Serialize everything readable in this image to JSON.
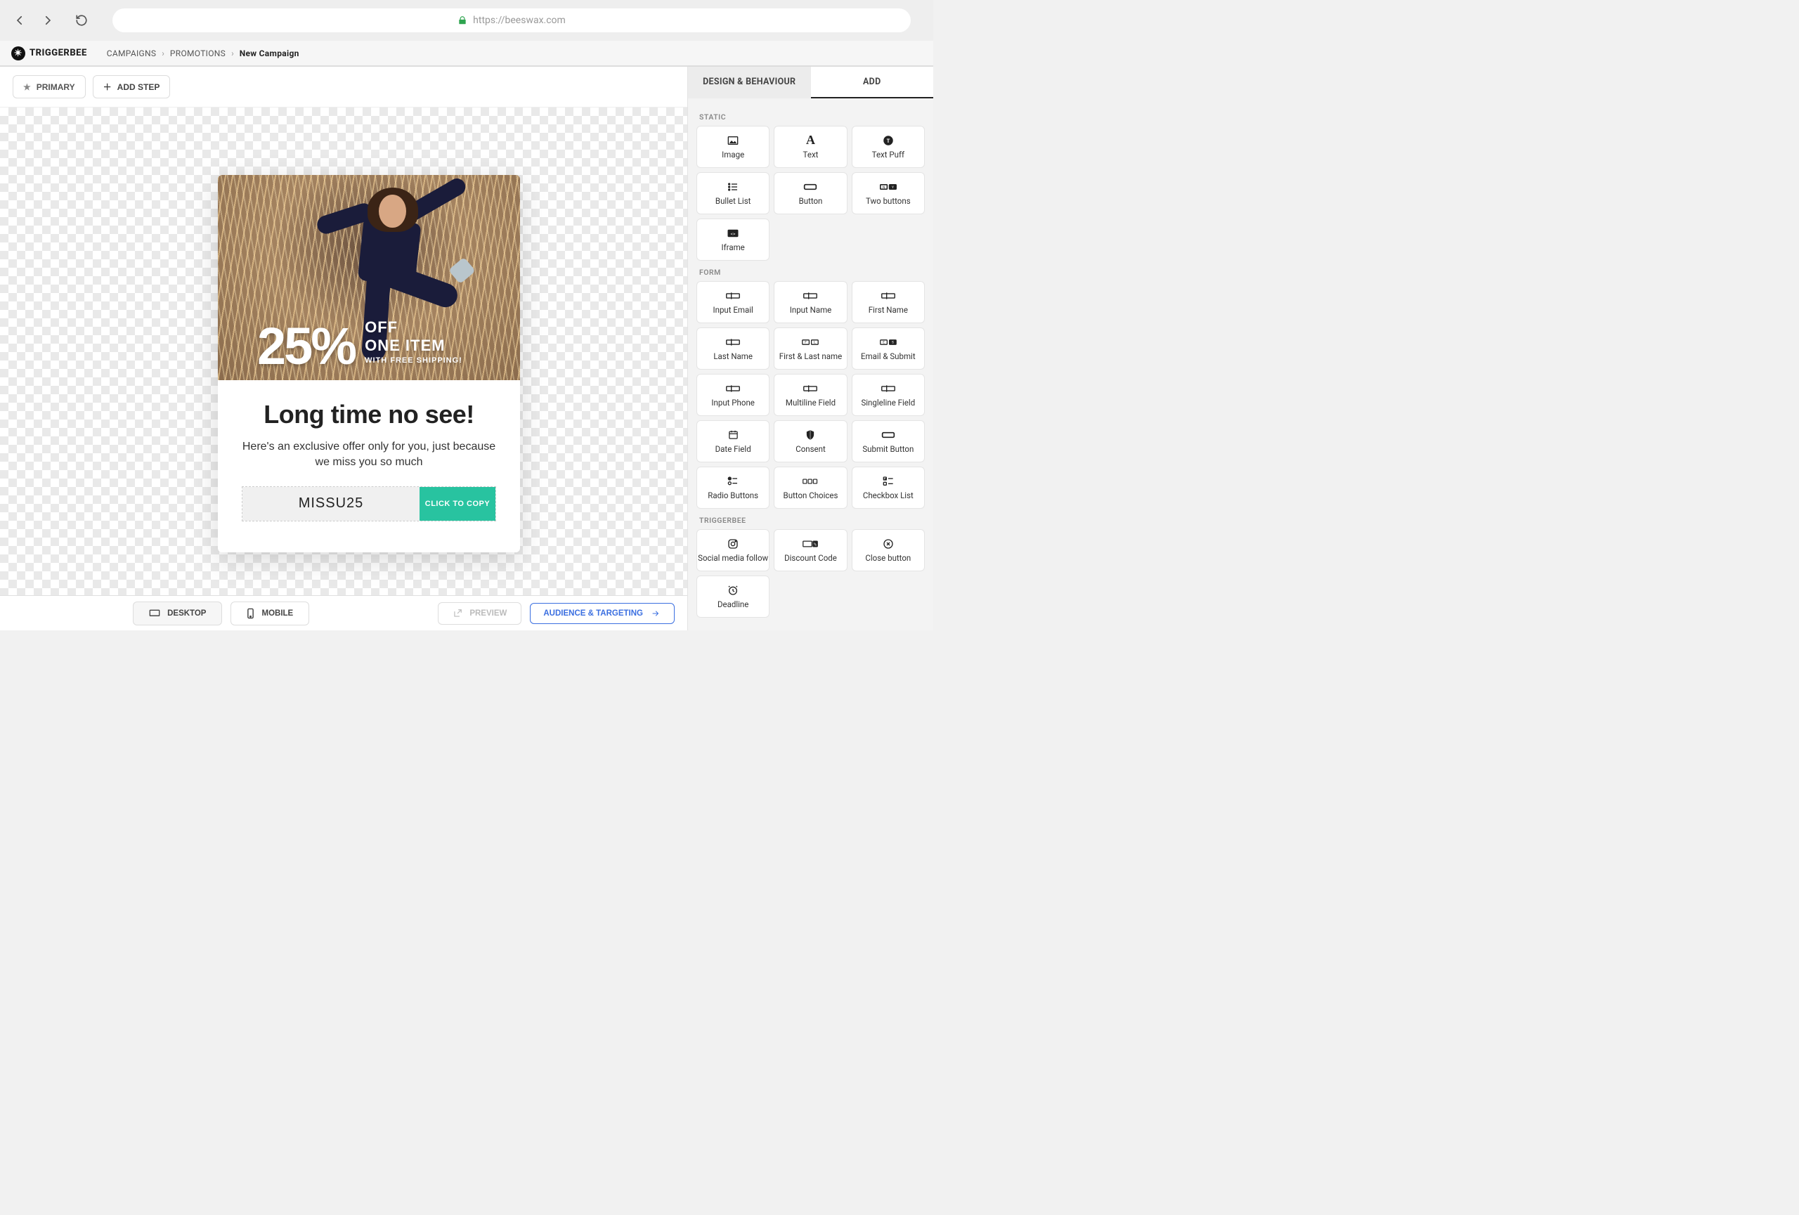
{
  "browser": {
    "url": "https://beeswax.com"
  },
  "logo": "TRIGGERBEE",
  "breadcrumbs": {
    "campaigns": "CAMPAIGNS",
    "promotions": "PROMOTIONS",
    "current": "New Campaign"
  },
  "toolbar": {
    "primary": "PRIMARY",
    "add_step": "ADD STEP"
  },
  "popup": {
    "percent": "25%",
    "line1": "OFF",
    "line2": "ONE ITEM",
    "line3": "WITH FREE SHIPPING!",
    "headline": "Long time no see!",
    "subline": "Here's an exclusive offer only for you, just because we miss you so much",
    "code": "MISSU25",
    "copy_label": "CLICK TO COPY"
  },
  "tabs": {
    "design": "DESIGN & BEHAVIOUR",
    "add": "ADD"
  },
  "groups": {
    "static": "STATIC",
    "form": "FORM",
    "triggerbee": "TRIGGERBEE"
  },
  "static_tiles": {
    "image": "Image",
    "text": "Text",
    "text_puff": "Text Puff",
    "bullet_list": "Bullet List",
    "button": "Button",
    "two_buttons": "Two buttons",
    "iframe": "Iframe"
  },
  "form_tiles": {
    "input_email": "Input Email",
    "input_name": "Input Name",
    "first_name": "First Name",
    "last_name": "Last Name",
    "first_last": "First & Last name",
    "email_submit": "Email & Submit",
    "input_phone": "Input Phone",
    "multiline": "Multiline Field",
    "singleline": "Singleline Field",
    "date_field": "Date Field",
    "consent": "Consent",
    "submit_button": "Submit Button",
    "radio_buttons": "Radio Buttons",
    "button_choices": "Button Choices",
    "checkbox_list": "Checkbox List"
  },
  "tb_tiles": {
    "social": "Social media follow",
    "discount": "Discount Code",
    "close": "Close button",
    "deadline": "Deadline"
  },
  "footer": {
    "desktop": "DESKTOP",
    "mobile": "MOBILE",
    "preview": "PREVIEW",
    "audience": "AUDIENCE & TARGETING"
  }
}
